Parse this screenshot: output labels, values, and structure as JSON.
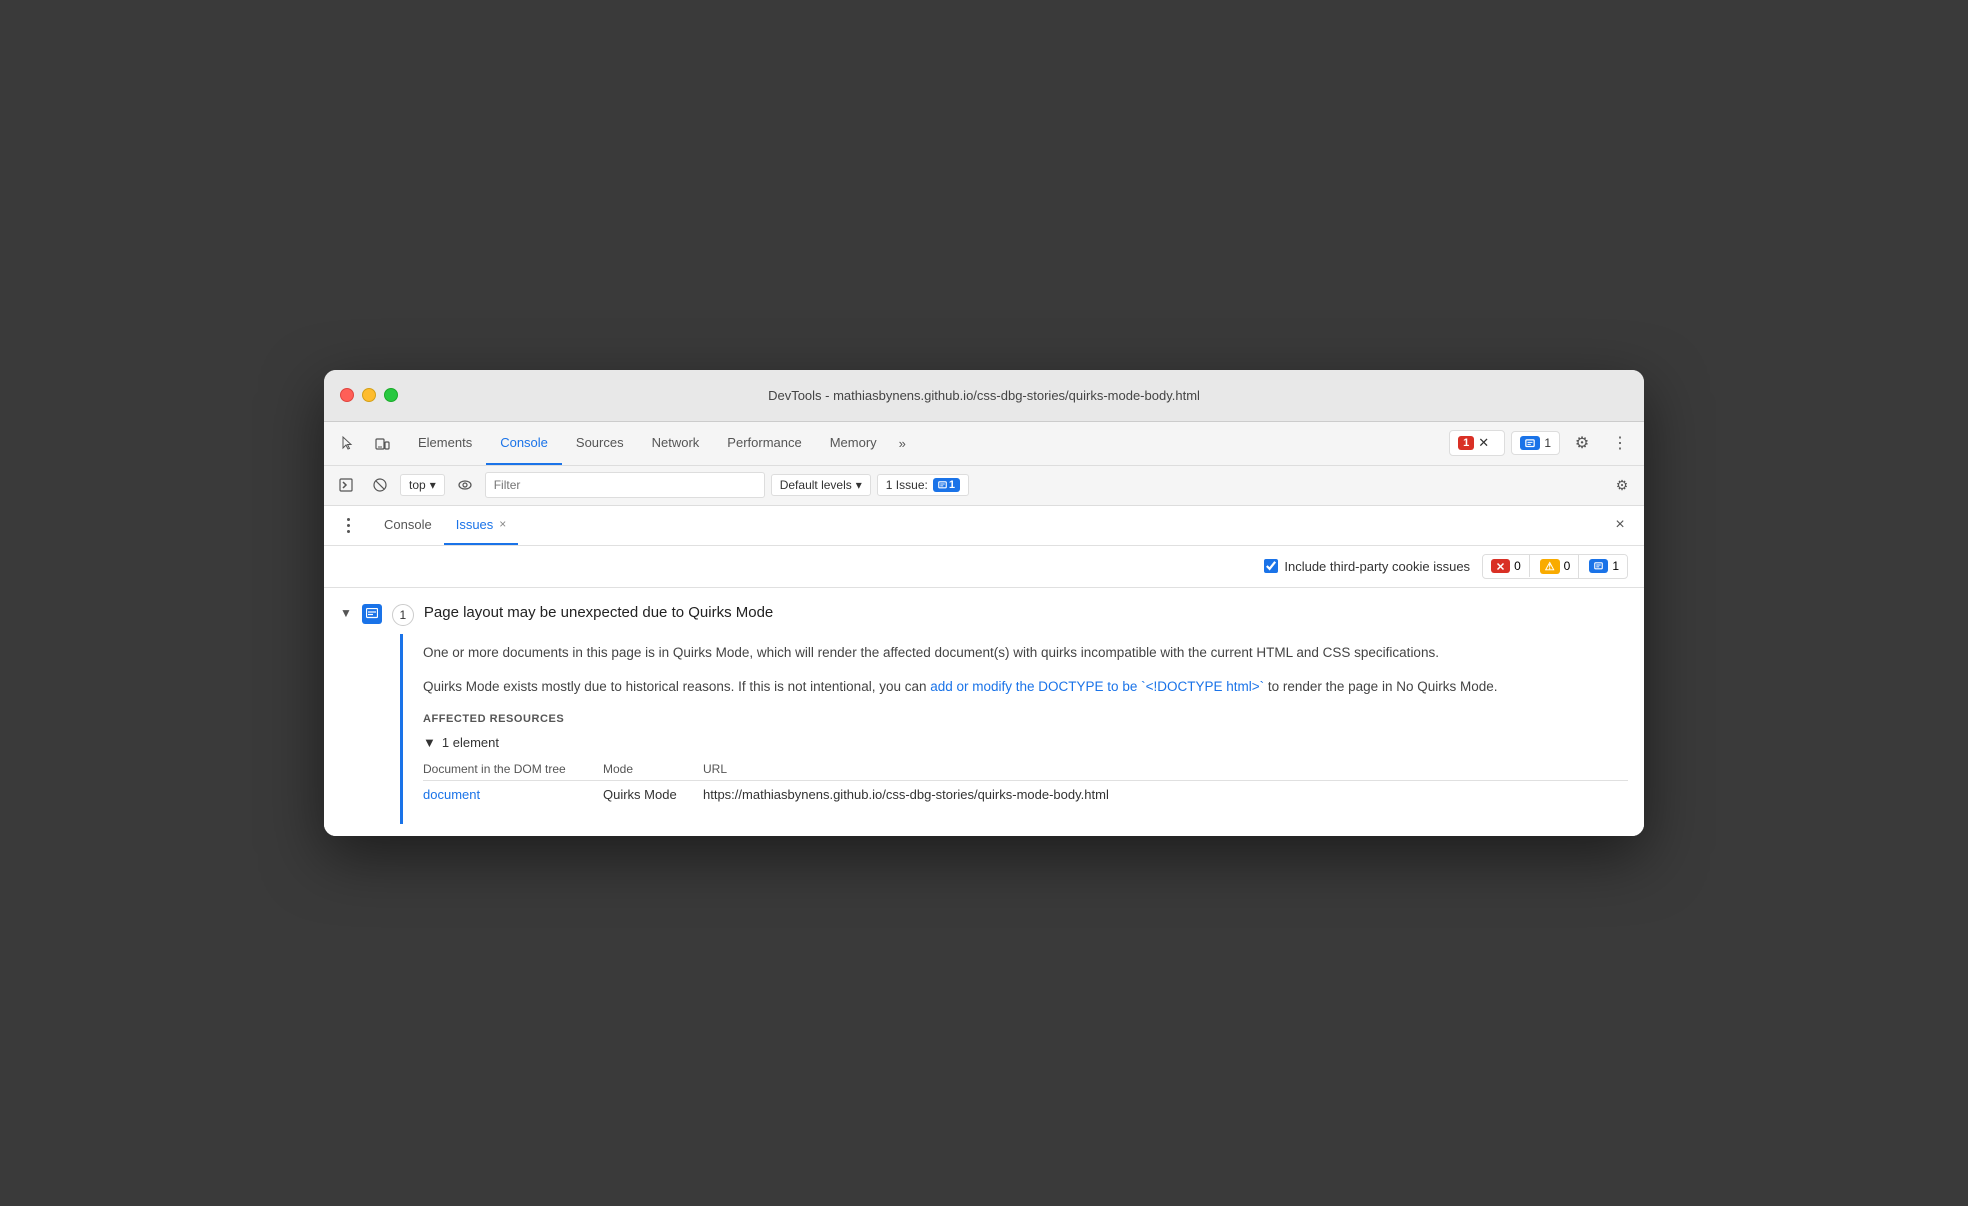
{
  "window": {
    "title": "DevTools - mathiasbynens.github.io/css-dbg-stories/quirks-mode-body.html"
  },
  "toolbar": {
    "tabs": [
      {
        "id": "elements",
        "label": "Elements",
        "active": false
      },
      {
        "id": "console",
        "label": "Console",
        "active": true
      },
      {
        "id": "sources",
        "label": "Sources",
        "active": false
      },
      {
        "id": "network",
        "label": "Network",
        "active": false
      },
      {
        "id": "performance",
        "label": "Performance",
        "active": false
      },
      {
        "id": "memory",
        "label": "Memory",
        "active": false
      }
    ],
    "more_label": "»",
    "error_count": "1",
    "message_count": "1",
    "settings_label": "⚙",
    "more_options_label": "⋮"
  },
  "console_toolbar": {
    "play_label": "▶",
    "block_label": "🚫",
    "top_label": "top",
    "eye_label": "👁",
    "filter_placeholder": "Filter",
    "levels_label": "Default levels",
    "issue_label": "1 Issue:",
    "issue_count": "1",
    "settings_label": "⚙"
  },
  "panel_tabs": {
    "console_label": "Console",
    "issues_label": "Issues",
    "close_label": "×"
  },
  "issues_filter": {
    "checkbox_label": "Include third-party cookie issues",
    "counts": [
      {
        "type": "error",
        "count": "0"
      },
      {
        "type": "warning",
        "count": "0"
      },
      {
        "type": "info",
        "count": "1"
      }
    ]
  },
  "issue": {
    "title": "Page layout may be unexpected due to Quirks Mode",
    "count": "1",
    "description_1": "One or more documents in this page is in Quirks Mode, which will render the affected document(s) with quirks incompatible with the current HTML and CSS specifications.",
    "description_2_pre": "Quirks Mode exists mostly due to historical reasons. If this is not intentional, you can ",
    "description_2_link": "add or modify the DOCTYPE to be `<!DOCTYPE html>`",
    "description_2_post": " to render the page in No Quirks Mode.",
    "affected_resources_label": "AFFECTED RESOURCES",
    "element_count_label": "1 element",
    "col_document": "Document in the DOM tree",
    "col_mode": "Mode",
    "col_url": "URL",
    "resource_link": "document",
    "resource_mode": "Quirks Mode",
    "resource_url": "https://mathiasbynens.github.io/css-dbg-stories/quirks-mode-body.html"
  },
  "icons": {
    "cursor": "⬖",
    "layers": "❒",
    "play": "▶",
    "block": "⊘",
    "eye": "◎",
    "chevron_down": "▼",
    "chevron_right": "▶",
    "gear": "⚙",
    "more": "⋮",
    "close": "×",
    "more_horiz": "⋯"
  }
}
